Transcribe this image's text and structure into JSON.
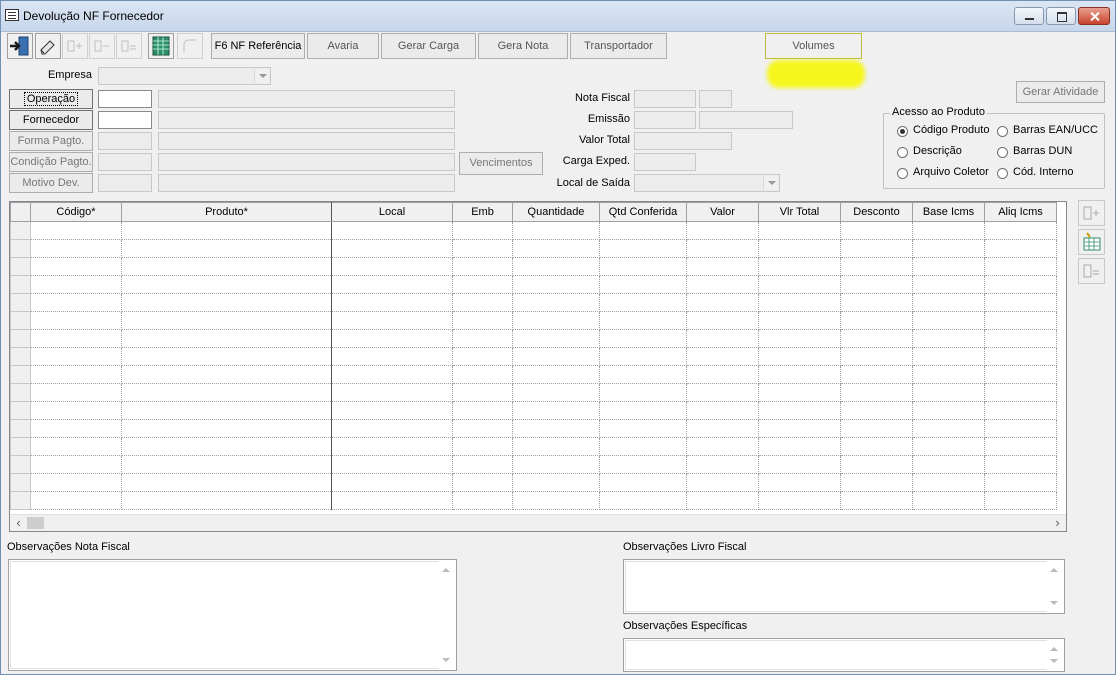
{
  "window": {
    "title": "Devolução NF Fornecedor",
    "controls": [
      "minimize",
      "maximize",
      "close"
    ]
  },
  "toolbar": {
    "icons": [
      "exit-door-icon",
      "eraser-icon",
      "add-record-icon",
      "insert-record-icon",
      "remove-record-icon",
      "spreadsheet-icon",
      "link-icon"
    ],
    "buttons": [
      {
        "label": "F6 NF Referência",
        "enabled": true
      },
      {
        "label": "Avaria",
        "enabled": false
      },
      {
        "label": "Gerar Carga",
        "enabled": false
      },
      {
        "label": "Gera Nota",
        "enabled": false
      },
      {
        "label": "Transportador",
        "enabled": false
      },
      {
        "label": "Volumes",
        "enabled": false,
        "highlighted": true,
        "highlight_color": "#f7f714"
      }
    ]
  },
  "form": {
    "empresa_label": "Empresa",
    "empresa_value": "",
    "operacao_button": "Operação",
    "fornecedor_button": "Fornecedor",
    "forma_pagto_button": "Forma Pagto.",
    "condicao_pagto_button": "Condição Pagto.",
    "motivo_dev_button": "Motivo Dev.",
    "vencimentos_button": "Vencimentos",
    "nota_fiscal_label": "Nota Fiscal",
    "emissao_label": "Emissão",
    "valor_total_label": "Valor Total",
    "carga_exped_label": "Carga Exped.",
    "local_saida_label": "Local de Saída",
    "local_saida_value": "",
    "gerar_atividade_button": "Gerar Atividade"
  },
  "acesso_produto": {
    "title": "Acesso ao Produto",
    "options": [
      {
        "label": "Código Produto",
        "checked": true
      },
      {
        "label": "Barras EAN/UCC",
        "checked": false
      },
      {
        "label": "Descrição",
        "checked": false
      },
      {
        "label": "Barras DUN",
        "checked": false
      },
      {
        "label": "Arquivo Coletor",
        "checked": false
      },
      {
        "label": "Cód. Interno",
        "checked": false
      }
    ]
  },
  "grid": {
    "columns": [
      "Código*",
      "Produto*",
      "Local",
      "Emb",
      "Quantidade",
      "Qtd Conferida",
      "Valor",
      "Vlr Total",
      "Desconto",
      "Base Icms",
      "Aliq Icms"
    ],
    "empty_rows": 16
  },
  "side_buttons": [
    "add-row-icon",
    "grid-edit-icon",
    "remove-row-icon"
  ],
  "observations": {
    "nota_fiscal_label": "Observações Nota Fiscal",
    "livro_fiscal_label": "Observações Livro Fiscal",
    "especificas_label": "Observações Específicas"
  },
  "colors": {
    "window_bg": "#f0f0f0",
    "title_bar": "#c7d6ea",
    "highlight": "#f7f714"
  }
}
